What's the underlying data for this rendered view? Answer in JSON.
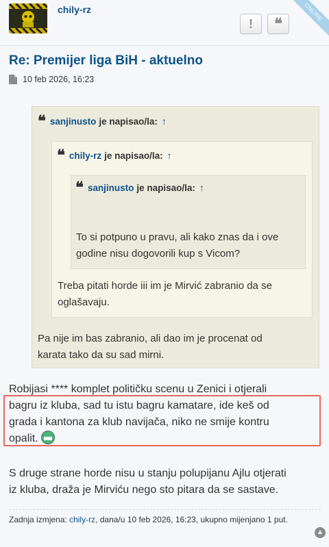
{
  "post": {
    "author": "chily-rz",
    "online_badge": "ONLINE",
    "report_icon": "!",
    "quote_icon": "❝",
    "title": "Re: Premijer liga BiH - aktuelno",
    "timestamp": "10 feb 2026, 16:23"
  },
  "quotes": {
    "outer": {
      "author": "sanjinusto",
      "wrote": "je napisao/la:",
      "arrow": "↑",
      "text_line1": "Pa nije im bas zabranio, ali dao im je procenat od",
      "text_line2": "karata tako da su sad mirni."
    },
    "middle": {
      "author": "chily-rz",
      "wrote": "je napisao/la:",
      "arrow": "↑",
      "text_line1": "Treba pitati horde iii im je Mirvić zabranio da se",
      "text_line2": "oglašavaju."
    },
    "inner": {
      "author": "sanjinusto",
      "wrote": "je napisao/la:",
      "arrow": "↑",
      "text_line1": "To si potpuno u pravu, ali kako znas da i ove",
      "text_line2": "godine nisu dogovorili kup s Vicom?"
    }
  },
  "body": {
    "p1_line1": "Robijasi **** komplet političku scenu u Zenici i otjerali",
    "p1_line2": "bagru iz kluba, sad tu istu bagru kamatare, ide keš od",
    "p1_line3": "grada i kantona za klub navijača, niko ne smije kontru",
    "p1_line4": "opalit.",
    "p2_line1": "S druge strane horde nisu u stanju polupijanu Ajlu otjerati",
    "p2_line2": "iz kluba, draža je Mirviću nego sto pitara da se sastave."
  },
  "edit": {
    "prefix": "Zadnja izmjena:",
    "editor": "chily-rz",
    "suffix": ", dana/u 10 feb 2026, 16:23, ukupno mijenjano 1 put."
  },
  "colors": {
    "link": "#105289",
    "highlight": "#e4685f",
    "quote_bg": "#ebeadd"
  }
}
